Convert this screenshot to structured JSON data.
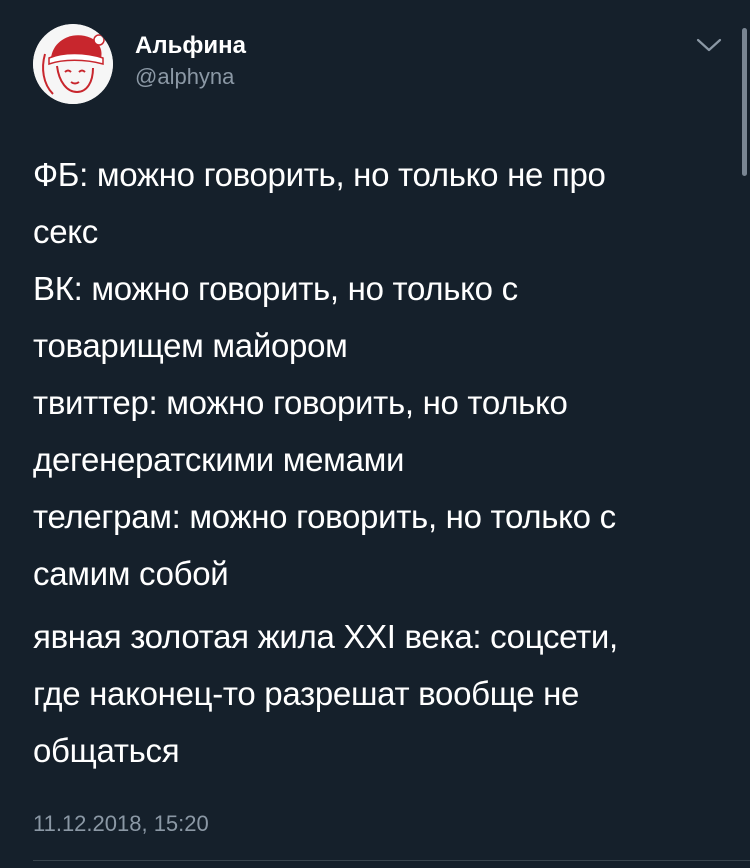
{
  "author": {
    "name": "Альфина",
    "handle": "@alphyna"
  },
  "tweet": {
    "lines": [
      "ФБ: можно говорить, но только не про",
      "секс",
      "ВК: можно говорить, но только с",
      "товарищем майором",
      "твиттер: можно говорить, но только",
      "дегенератскими мемами",
      "телеграм: можно говорить, но только с",
      "самим собой"
    ],
    "lines2": [
      "явная золотая жила XXI века: соцсети,",
      "где наконец-то разрешат вообще не",
      "общаться"
    ],
    "timestamp": "11.12.2018, 15:20"
  },
  "icons": {
    "more": "chevron-down-icon",
    "avatar": "avatar-illustration"
  },
  "colors": {
    "background": "#15202b",
    "text": "#ffffff",
    "secondary": "#8b98a5",
    "avatar_accent": "#c8262d"
  }
}
